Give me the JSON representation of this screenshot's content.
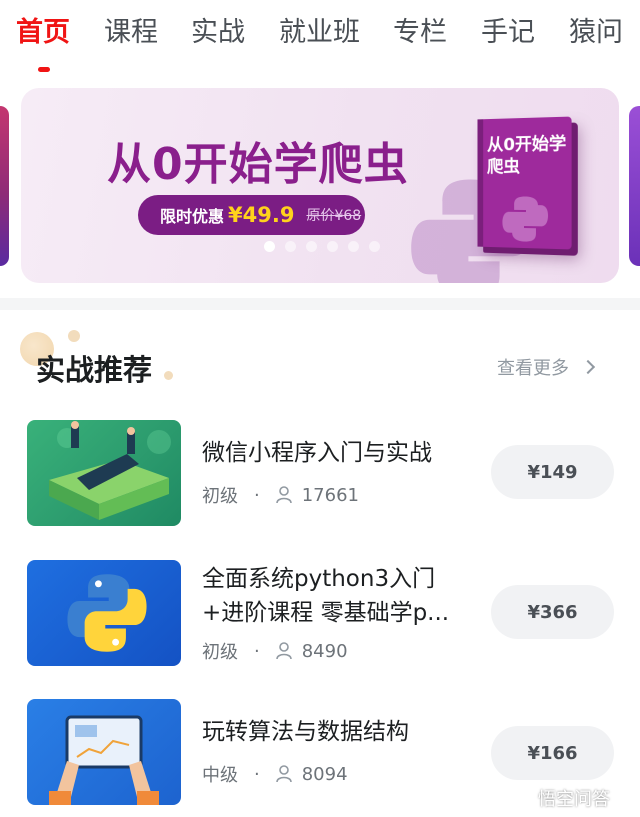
{
  "tabs": [
    {
      "label": "首页",
      "active": true
    },
    {
      "label": "课程",
      "active": false
    },
    {
      "label": "实战",
      "active": false
    },
    {
      "label": "就业班",
      "active": false
    },
    {
      "label": "专栏",
      "active": false
    },
    {
      "label": "手记",
      "active": false
    },
    {
      "label": "猿问",
      "active": false
    }
  ],
  "banner": {
    "title": "从0开始学爬虫",
    "promo_label": "限时优惠",
    "promo_price": "¥49.9",
    "original_price": "原价¥68",
    "book_title": "从0开始学爬虫",
    "slide_count": 6,
    "active_slide": 1
  },
  "section": {
    "title": "实战推荐",
    "more_label": "查看更多"
  },
  "courses": [
    {
      "title": "微信小程序入门与实战",
      "level": "初级",
      "separator": "·",
      "learners": "17661",
      "price": "¥149",
      "thumb_icon": "phone-illustration"
    },
    {
      "title": "全面系统python3入门+进阶课程 零基础学p...",
      "level": "初级",
      "separator": "·",
      "learners": "8490",
      "price": "¥366",
      "thumb_icon": "python-logo"
    },
    {
      "title": "玩转算法与数据结构",
      "level": "中级",
      "separator": "·",
      "learners": "8094",
      "price": "¥166",
      "thumb_icon": "tablet-chart-illustration"
    }
  ],
  "watermark": "悟空问答",
  "colors": {
    "accent": "#f01414",
    "banner_purple": "#7b1d84",
    "price_yellow": "#ffd21c"
  }
}
